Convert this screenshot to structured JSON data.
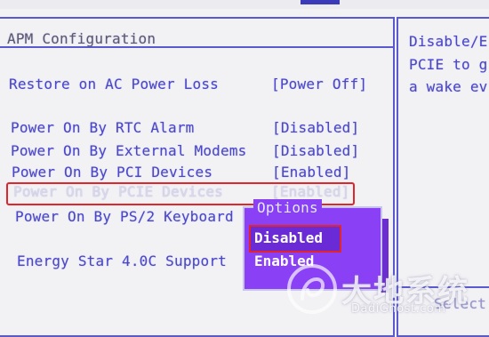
{
  "screen": {
    "title": "APM Configuration",
    "settings": [
      {
        "label": "Restore on AC Power Loss",
        "value": "[Power Off]"
      },
      {
        "label": "Power On By RTC Alarm",
        "value": "[Disabled]"
      },
      {
        "label": "Power On By External Modems",
        "value": "[Disabled]"
      },
      {
        "label": "Power On By PCI Devices",
        "value": "[Enabled]"
      },
      {
        "label": "Power On By PCIE Devices",
        "value": "[Enabled]"
      },
      {
        "label": "Power On By PS/2 Keyboard",
        "value": ""
      },
      {
        "label": "Energy Star 4.0C Support",
        "value": ""
      }
    ]
  },
  "help": {
    "lines": [
      "Disable/E",
      "PCIE to g",
      "a wake ev"
    ],
    "bottom": "Select"
  },
  "options_popup": {
    "title": "Options",
    "items": [
      "Disabled",
      "Enabled"
    ],
    "selected": "Disabled"
  },
  "watermark": {
    "text": "大地系统",
    "url": "DadiGhost.com"
  },
  "colors": {
    "bios_text": "#4a48c9",
    "frame": "#5a59cf",
    "highlight_border": "#e0262c",
    "popup_bg": "#8a40f5",
    "background": "#f2f1f4"
  }
}
